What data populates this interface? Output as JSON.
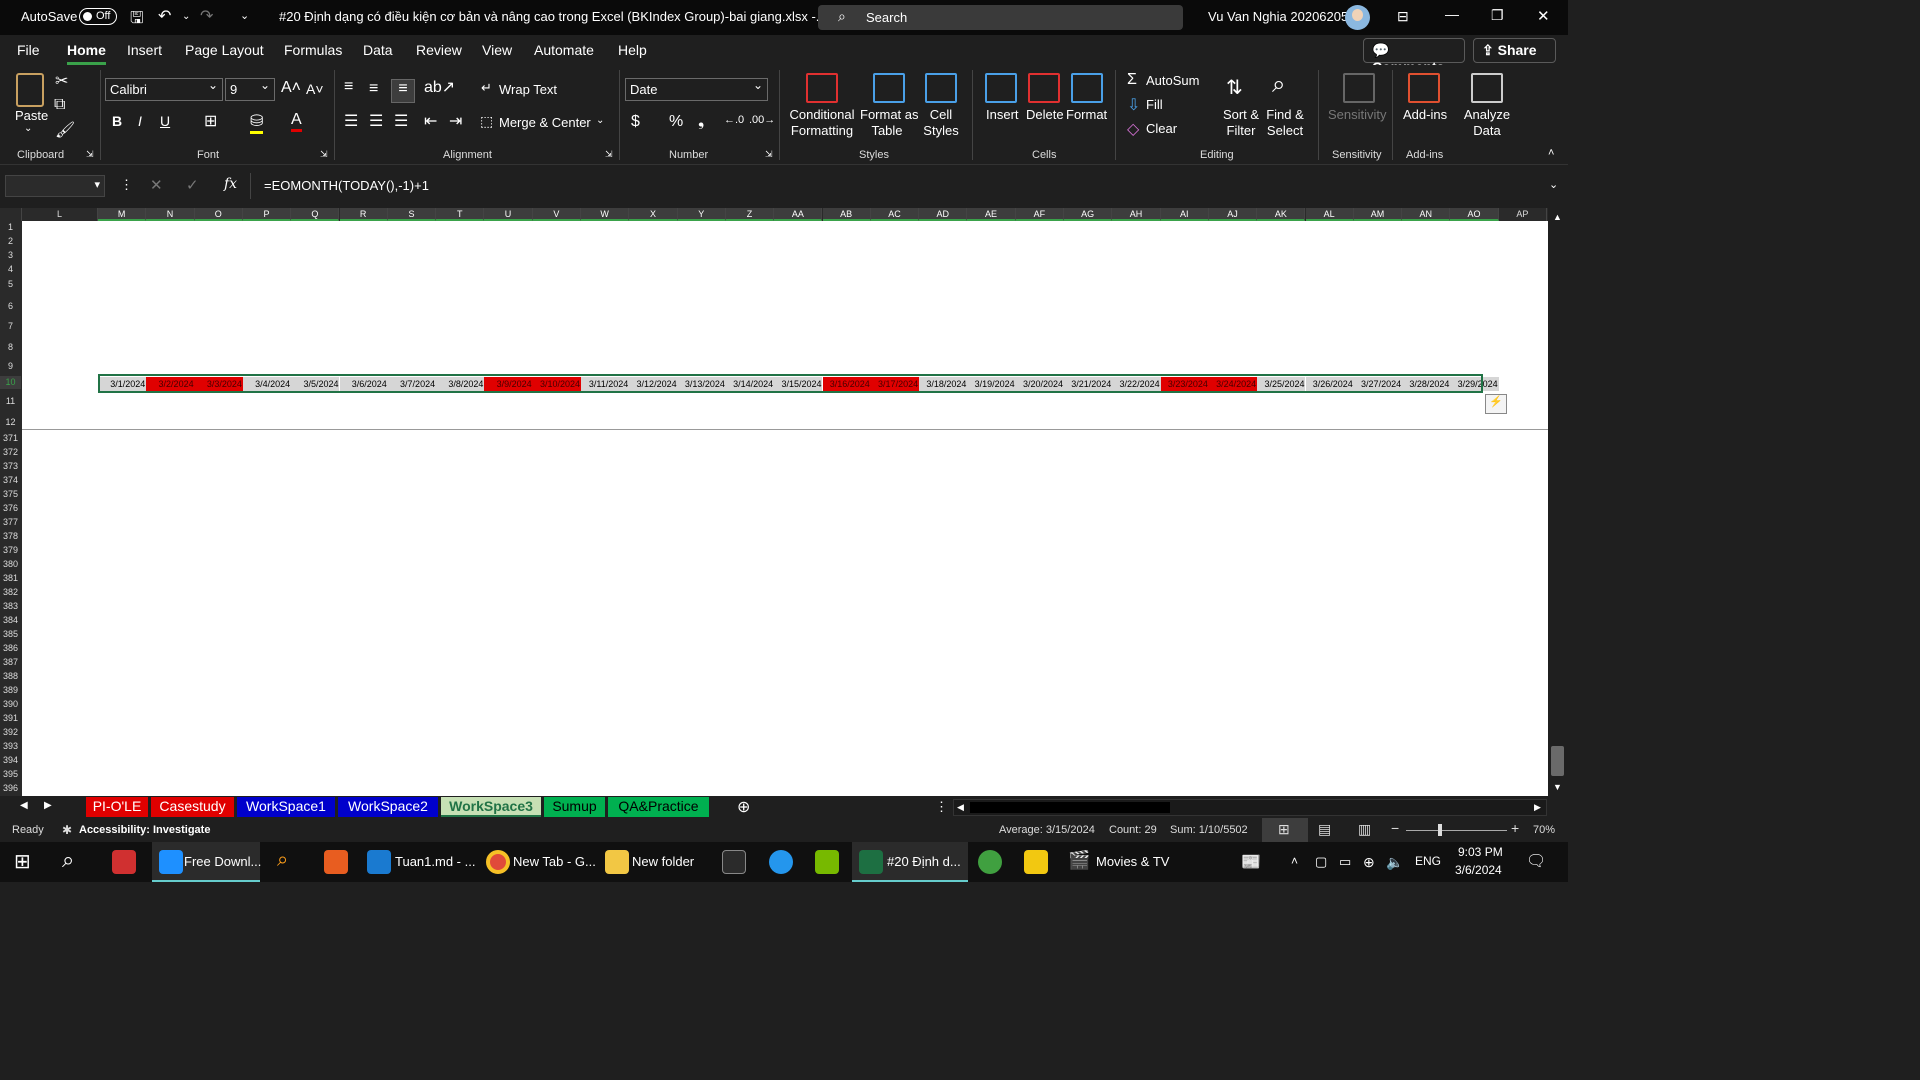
{
  "titlebar": {
    "autosave_label": "AutoSave",
    "autosave_state": "Off",
    "file_title": "#20 Định dạng có điều kiện cơ bản và nâng cao trong Excel (BKIndex Group)-bai giang.xlsx  -...",
    "search_placeholder": "Search",
    "user_name": "Vu Van Nghia 20206205"
  },
  "menu": {
    "items": [
      "File",
      "Home",
      "Insert",
      "Page Layout",
      "Formulas",
      "Data",
      "Review",
      "View",
      "Automate",
      "Help"
    ],
    "comments": "Comments",
    "share": "Share"
  },
  "ribbon": {
    "clipboard": {
      "paste": "Paste",
      "label": "Clipboard"
    },
    "font": {
      "name": "Calibri",
      "size": "9",
      "label": "Font"
    },
    "alignment": {
      "wrap": "Wrap Text",
      "merge": "Merge & Center",
      "label": "Alignment"
    },
    "number": {
      "format": "Date",
      "label": "Number"
    },
    "styles": {
      "cond1": "Conditional",
      "cond2": "Formatting",
      "fat1": "Format as",
      "fat2": "Table",
      "cs1": "Cell",
      "cs2": "Styles",
      "label": "Styles"
    },
    "cells": {
      "insert": "Insert",
      "delete": "Delete",
      "format": "Format",
      "label": "Cells"
    },
    "editing": {
      "autosum": "AutoSum",
      "fill": "Fill",
      "clear": "Clear",
      "sort1": "Sort &",
      "sort2": "Filter",
      "find1": "Find &",
      "find2": "Select",
      "label": "Editing"
    },
    "sensitivity": {
      "btn": "Sensitivity",
      "label": "Sensitivity"
    },
    "addins": {
      "btn": "Add-ins",
      "label": "Add-ins"
    },
    "analyze": {
      "l1": "Analyze",
      "l2": "Data"
    }
  },
  "formula_bar": {
    "fx": "fx",
    "formula": "=EOMONTH(TODAY(),-1)+1"
  },
  "columns": [
    "L",
    "M",
    "N",
    "O",
    "P",
    "Q",
    "R",
    "S",
    "T",
    "U",
    "V",
    "W",
    "X",
    "Y",
    "Z",
    "AA",
    "AB",
    "AC",
    "AD",
    "AE",
    "AF",
    "AG",
    "AH",
    "AI",
    "AJ",
    "AK",
    "AL",
    "AM",
    "AN",
    "AO",
    "AP"
  ],
  "rows": [
    "1",
    "2",
    "3",
    "4",
    "5",
    "6",
    "7",
    "8",
    "9",
    "10",
    "11",
    "12",
    "371",
    "372",
    "373",
    "374",
    "375",
    "376",
    "377",
    "378",
    "379",
    "380",
    "381",
    "382",
    "383",
    "384",
    "385",
    "386",
    "387",
    "388",
    "389",
    "390",
    "391",
    "392",
    "393",
    "394",
    "395",
    "396"
  ],
  "date_cells": [
    {
      "v": "3/1/2024",
      "red": false
    },
    {
      "v": "3/2/2024",
      "red": true
    },
    {
      "v": "3/3/2024",
      "red": true
    },
    {
      "v": "3/4/2024",
      "red": false
    },
    {
      "v": "3/5/2024",
      "red": false
    },
    {
      "v": "3/6/2024",
      "red": false
    },
    {
      "v": "3/7/2024",
      "red": false
    },
    {
      "v": "3/8/2024",
      "red": false
    },
    {
      "v": "3/9/2024",
      "red": true
    },
    {
      "v": "3/10/2024",
      "red": true
    },
    {
      "v": "3/11/2024",
      "red": false
    },
    {
      "v": "3/12/2024",
      "red": false
    },
    {
      "v": "3/13/2024",
      "red": false
    },
    {
      "v": "3/14/2024",
      "red": false
    },
    {
      "v": "3/15/2024",
      "red": false
    },
    {
      "v": "3/16/2024",
      "red": true
    },
    {
      "v": "3/17/2024",
      "red": true
    },
    {
      "v": "3/18/2024",
      "red": false
    },
    {
      "v": "3/19/2024",
      "red": false
    },
    {
      "v": "3/20/2024",
      "red": false
    },
    {
      "v": "3/21/2024",
      "red": false
    },
    {
      "v": "3/22/2024",
      "red": false
    },
    {
      "v": "3/23/2024",
      "red": true
    },
    {
      "v": "3/24/2024",
      "red": true
    },
    {
      "v": "3/25/2024",
      "red": false
    },
    {
      "v": "3/26/2024",
      "red": false
    },
    {
      "v": "3/27/2024",
      "red": false
    },
    {
      "v": "3/28/2024",
      "red": false
    },
    {
      "v": "3/29/2024",
      "red": false
    }
  ],
  "sheet_tabs": [
    {
      "name": "PI-O'LE",
      "bg": "#e00000",
      "fg": "#ffffff"
    },
    {
      "name": "Casestudy",
      "bg": "#e00000",
      "fg": "#ffffff"
    },
    {
      "name": "WorkSpace1",
      "bg": "#0000cc",
      "fg": "#ffffff"
    },
    {
      "name": "WorkSpace2",
      "bg": "#0000cc",
      "fg": "#ffffff"
    },
    {
      "name": "WorkSpace3",
      "bg": "#c6e0b4",
      "fg": "#217346"
    },
    {
      "name": "Sumup",
      "bg": "#00b050",
      "fg": "#000000"
    },
    {
      "name": "QA&Practice",
      "bg": "#00b050",
      "fg": "#000000"
    }
  ],
  "status": {
    "ready": "Ready",
    "accessibility": "Accessibility: Investigate",
    "average": "Average: 3/15/2024",
    "count": "Count: 29",
    "sum": "Sum: 1/10/5502",
    "zoom": "70%"
  },
  "taskbar": {
    "items": [
      "Free Downl...",
      "Tuan1.md - ...",
      "New Tab - G...",
      "New folder",
      "#20 Định d...",
      "Movies & TV"
    ],
    "lang": "ENG",
    "time": "9:03 PM",
    "date": "3/6/2024"
  },
  "colors": {
    "accent": "#217346",
    "highlight_red": "#e00000",
    "weekday_fill": "#d6d6d6"
  }
}
